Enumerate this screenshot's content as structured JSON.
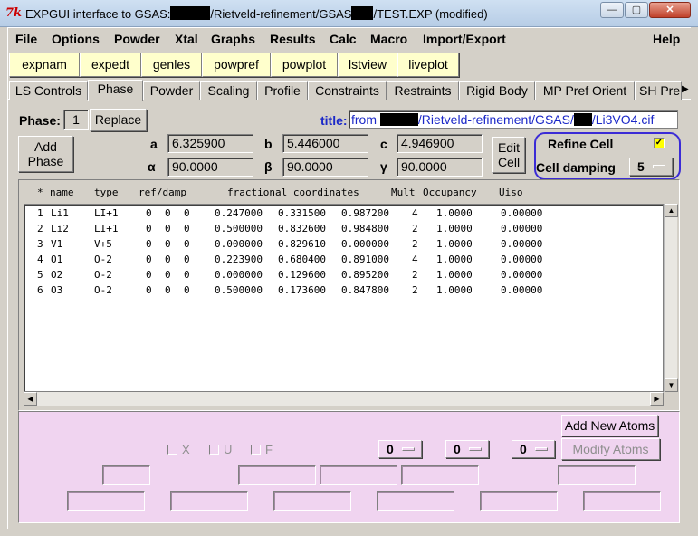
{
  "window": {
    "title_prefix": "EXPGUI interface to GSAS:",
    "title_suffix": "/Rietveld-refinement/GSAS",
    "title_end": "/TEST.EXP (modified)",
    "buttons": [
      "—",
      "▢",
      "✕"
    ]
  },
  "menubar": {
    "left": [
      "File",
      "Options",
      "Powder",
      "Xtal",
      "Graphs",
      "Results",
      "Calc",
      "Macro",
      "Import/Export"
    ],
    "help": "Help"
  },
  "toolbar": [
    "expnam",
    "expedt",
    "genles",
    "powpref",
    "powplot",
    "lstview",
    "liveplot"
  ],
  "tabs": {
    "items": [
      "LS Controls",
      "Phase",
      "Powder",
      "Scaling",
      "Profile",
      "Constraints",
      "Restraints",
      "Rigid Body",
      "MP Pref Orient",
      "SH Pre"
    ],
    "active": "Phase",
    "more_arrow": "▶"
  },
  "phase": {
    "label": "Phase:",
    "number": "1",
    "replace_button": "Replace",
    "add_button_line1": "Add",
    "add_button_line2": "Phase",
    "title_label": "title:",
    "title_from": "from",
    "title_mid": "/Rietveld-refinement/GSAS/",
    "title_end": "/Li3VO4.cif",
    "cell": {
      "a_label": "a",
      "a": "6.325900",
      "b_label": "b",
      "b": "5.446000",
      "c_label": "c",
      "c": "4.946900",
      "alpha_label": "α",
      "alpha": "90.0000",
      "beta_label": "β",
      "beta": "90.0000",
      "gamma_label": "γ",
      "gamma": "90.0000"
    },
    "edit_cell_line1": "Edit",
    "edit_cell_line2": "Cell",
    "refine_cell_label": "Refine Cell",
    "refine_cell_checked": "✓",
    "cell_damping_label": "Cell damping",
    "cell_damping_value": "5"
  },
  "atoms": {
    "header": {
      "star": "*",
      "name": "name",
      "type": "type",
      "refdamp": "ref/damp",
      "frac": "fractional coordinates",
      "mult": "Mult",
      "occ": "Occupancy",
      "uiso": "Uiso"
    },
    "rows": [
      {
        "n": "1",
        "name": "Li1",
        "type": "LI+1",
        "r1": "0",
        "r2": "0",
        "r3": "0",
        "x": "0.247000",
        "y": "0.331500",
        "z": "0.987200",
        "mult": "4",
        "occ": "1.0000",
        "uiso": "0.00000"
      },
      {
        "n": "2",
        "name": "Li2",
        "type": "LI+1",
        "r1": "0",
        "r2": "0",
        "r3": "0",
        "x": "0.500000",
        "y": "0.832600",
        "z": "0.984800",
        "mult": "2",
        "occ": "1.0000",
        "uiso": "0.00000"
      },
      {
        "n": "3",
        "name": "V1",
        "type": "V+5",
        "r1": "0",
        "r2": "0",
        "r3": "0",
        "x": "0.000000",
        "y": "0.829610",
        "z": "0.000000",
        "mult": "2",
        "occ": "1.0000",
        "uiso": "0.00000"
      },
      {
        "n": "4",
        "name": "O1",
        "type": "O-2",
        "r1": "0",
        "r2": "0",
        "r3": "0",
        "x": "0.223900",
        "y": "0.680400",
        "z": "0.891000",
        "mult": "4",
        "occ": "1.0000",
        "uiso": "0.00000"
      },
      {
        "n": "5",
        "name": "O2",
        "type": "O-2",
        "r1": "0",
        "r2": "0",
        "r3": "0",
        "x": "0.000000",
        "y": "0.129600",
        "z": "0.895200",
        "mult": "2",
        "occ": "1.0000",
        "uiso": "0.00000"
      },
      {
        "n": "6",
        "name": "O3",
        "type": "O-2",
        "r1": "0",
        "r2": "0",
        "r3": "0",
        "x": "0.500000",
        "y": "0.173600",
        "z": "0.847800",
        "mult": "2",
        "occ": "1.0000",
        "uiso": "0.00000"
      }
    ]
  },
  "edit_panel": {
    "add_new_atoms": "Add New Atoms",
    "modify_atoms": "Modify Atoms",
    "check_x": "X",
    "check_u": "U",
    "check_f": "F",
    "menu1": "0",
    "menu2": "0",
    "menu3": "0"
  }
}
